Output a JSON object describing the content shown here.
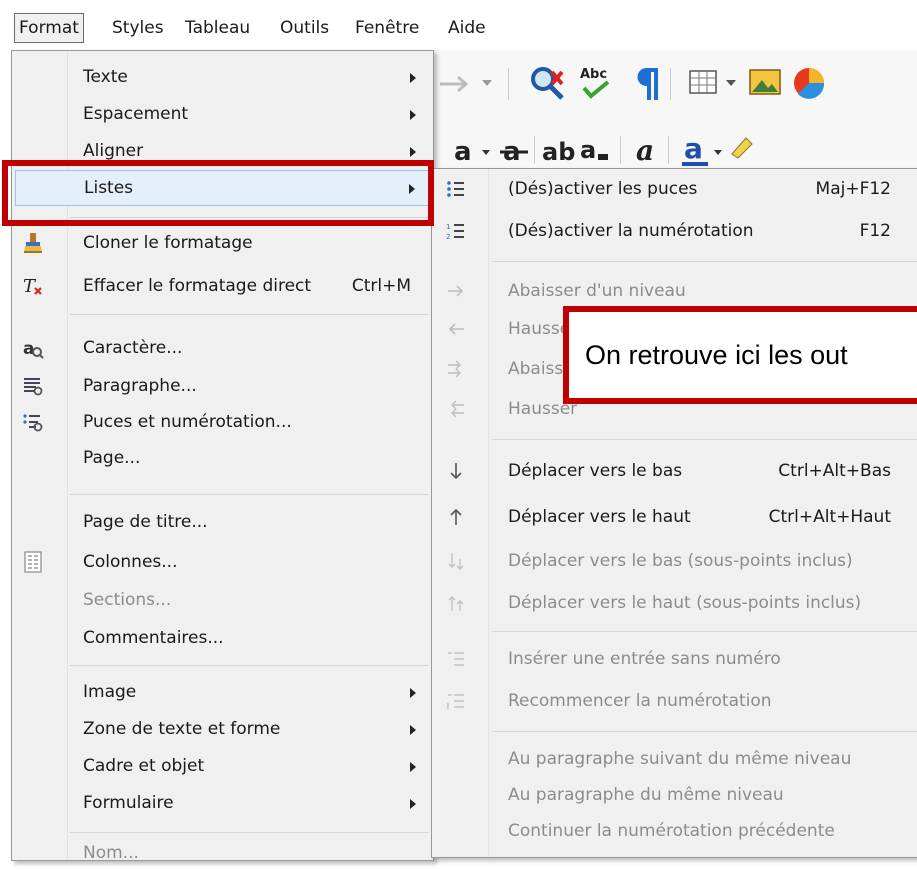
{
  "menubar": {
    "items": [
      "Format",
      "Styles",
      "Tableau",
      "Outils",
      "Fenêtre",
      "Aide"
    ]
  },
  "format_menu": {
    "items": [
      {
        "label": "Texte",
        "submenu": true
      },
      {
        "label": "Espacement",
        "submenu": true
      },
      {
        "label": "Aligner",
        "submenu": true
      },
      {
        "label": "Listes",
        "submenu": true,
        "highlighted": true
      },
      {
        "label": "Cloner le formatage",
        "icon": "clone-formatting-brush-icon"
      },
      {
        "label": "Effacer le formatage direct",
        "shortcut": "Ctrl+M",
        "icon": "clear-formatting-icon"
      },
      {
        "label": "Caractère...",
        "icon": "character-icon"
      },
      {
        "label": "Paragraphe...",
        "icon": "paragraph-icon"
      },
      {
        "label": "Puces et numérotation...",
        "icon": "bullets-numbering-icon"
      },
      {
        "label": "Page..."
      },
      {
        "label": "Page de titre..."
      },
      {
        "label": "Colonnes...",
        "icon": "columns-icon"
      },
      {
        "label": "Sections...",
        "disabled": true
      },
      {
        "label": "Commentaires..."
      },
      {
        "label": "Image",
        "submenu": true
      },
      {
        "label": "Zone de texte et forme",
        "submenu": true
      },
      {
        "label": "Cadre et objet",
        "submenu": true
      },
      {
        "label": "Formulaire",
        "submenu": true
      },
      {
        "label": "Nom...",
        "disabled": true
      }
    ]
  },
  "lists_submenu": {
    "items": [
      {
        "label": "(Dés)activer les puces",
        "shortcut": "Maj+F12",
        "icon": "toggle-bullets-icon"
      },
      {
        "label": "(Dés)activer la numérotation",
        "shortcut": "F12",
        "icon": "toggle-numbering-icon"
      },
      {
        "label": "Abaisser d'un niveau",
        "disabled": true,
        "icon": "demote-arrow-icon"
      },
      {
        "label": "Hausser",
        "disabled": true,
        "icon": "promote-arrow-icon"
      },
      {
        "label": "Abaisser",
        "disabled": true,
        "icon": "demote-subpoints-icon"
      },
      {
        "label": "Hausser",
        "disabled": true,
        "icon": "promote-subpoints-icon"
      },
      {
        "label": "Déplacer vers le bas",
        "shortcut": "Ctrl+Alt+Bas",
        "icon": "move-down-icon"
      },
      {
        "label": "Déplacer vers le haut",
        "shortcut": "Ctrl+Alt+Haut",
        "icon": "move-up-icon"
      },
      {
        "label": "Déplacer vers le bas (sous-points inclus)",
        "disabled": true,
        "icon": "move-down-subpoints-icon"
      },
      {
        "label": "Déplacer vers le haut (sous-points inclus)",
        "disabled": true,
        "icon": "move-up-subpoints-icon"
      },
      {
        "label": "Insérer une entrée sans numéro",
        "disabled": true,
        "icon": "insert-unnumbered-entry-icon"
      },
      {
        "label": "Recommencer la numérotation",
        "disabled": true,
        "icon": "restart-numbering-icon"
      },
      {
        "label": "Au paragraphe suivant du même niveau",
        "disabled": true
      },
      {
        "label": "Au paragraphe du même niveau",
        "disabled": true
      },
      {
        "label": "Continuer la numérotation précédente",
        "disabled": true
      }
    ]
  },
  "annotation": {
    "callout_text": "On retrouve ici les out",
    "color": "#c00000"
  },
  "colors": {
    "menu_bg": "#f0f0f0",
    "highlight": "#e5eff9",
    "disabled_text": "#8c8c8c"
  }
}
